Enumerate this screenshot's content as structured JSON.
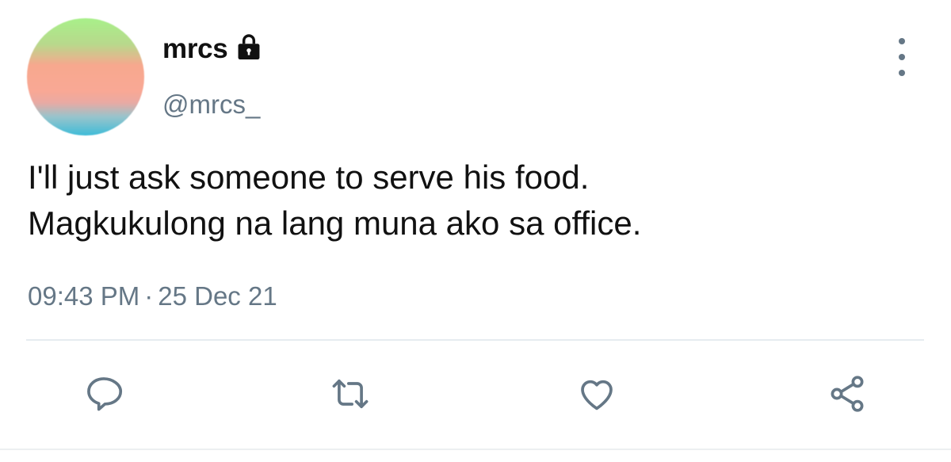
{
  "user": {
    "display_name": "mrcs",
    "handle": "@mrcs_",
    "protected_icon": "lock-icon"
  },
  "tweet": {
    "text": "I'll just ask someone to serve his food.\nMagkukulong na lang muna ako sa office.",
    "time": "09:43 PM",
    "separator": "·",
    "date": "25 Dec 21"
  },
  "actions": [
    {
      "name": "reply",
      "icon": "speech-bubble-icon"
    },
    {
      "name": "retweet",
      "icon": "retweet-icon"
    },
    {
      "name": "like",
      "icon": "heart-icon"
    },
    {
      "name": "share",
      "icon": "share-icon"
    }
  ],
  "menu": {
    "icon": "vertical-ellipsis-icon"
  },
  "colors": {
    "text": "#111111",
    "secondary": "#657786",
    "divider": "#e6ecf0"
  }
}
